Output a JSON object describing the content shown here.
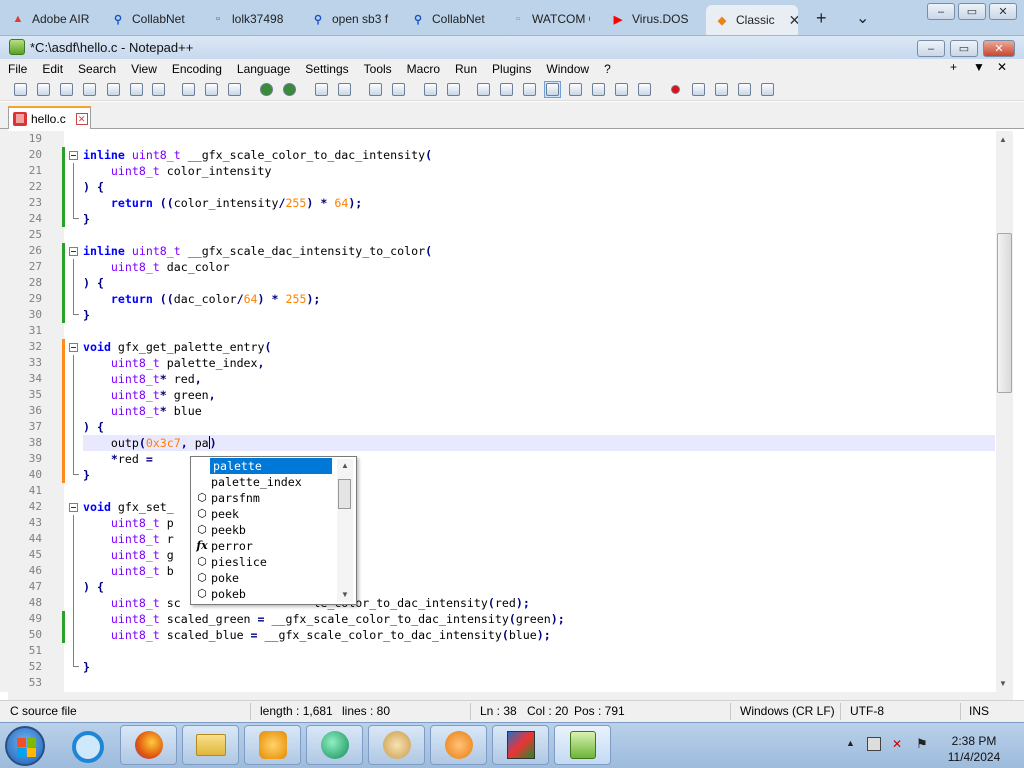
{
  "browser_tabs": [
    {
      "label": "Adobe AIR",
      "icon": "adobe-icon",
      "color": "#e03c31"
    },
    {
      "label": "CollabNet",
      "icon": "search-icon",
      "color": "#1a55c8"
    },
    {
      "label": "lolk37498",
      "icon": "document-icon",
      "color": "#555555"
    },
    {
      "label": "open sb3 f",
      "icon": "search-icon",
      "color": "#1a55c8"
    },
    {
      "label": "CollabNet",
      "icon": "search-icon",
      "color": "#1a55c8"
    },
    {
      "label": "WATCOM GM",
      "icon": "blank-icon",
      "color": "#888888"
    },
    {
      "label": "Virus.DOS",
      "icon": "youtube-icon",
      "color": "#ff0000"
    },
    {
      "label": "Classic",
      "icon": "scratch-icon",
      "color": "#e8841a",
      "active": true
    }
  ],
  "new_tab": "+",
  "tab_list": "⌄",
  "window_title": "*C:\\asdf\\hello.c - Notepad++",
  "menu": [
    "File",
    "Edit",
    "Search",
    "View",
    "Encoding",
    "Language",
    "Settings",
    "Tools",
    "Macro",
    "Run",
    "Plugins",
    "Window",
    "?"
  ],
  "menu_right": [
    "+",
    "▼",
    "✕"
  ],
  "document_tab": {
    "label": "hello.c",
    "close": "✕"
  },
  "editor": {
    "lines": [
      {
        "n": "19",
        "t": ""
      },
      {
        "n": "20",
        "t": "inline uint8_t __gfx_scale_color_to_dac_intensity("
      },
      {
        "n": "21",
        "t": "    uint8_t color_intensity"
      },
      {
        "n": "22",
        "t": ") {"
      },
      {
        "n": "23",
        "t": "    return ((color_intensity/255) * 64);"
      },
      {
        "n": "24",
        "t": "}"
      },
      {
        "n": "25",
        "t": ""
      },
      {
        "n": "26",
        "t": "inline uint8_t __gfx_scale_dac_intensity_to_color("
      },
      {
        "n": "27",
        "t": "    uint8_t dac_color"
      },
      {
        "n": "28",
        "t": ") {"
      },
      {
        "n": "29",
        "t": "    return ((dac_color/64) * 255);"
      },
      {
        "n": "30",
        "t": "}"
      },
      {
        "n": "31",
        "t": ""
      },
      {
        "n": "32",
        "t": "void gfx_get_palette_entry("
      },
      {
        "n": "33",
        "t": "    uint8_t palette_index,"
      },
      {
        "n": "34",
        "t": "    uint8_t* red,"
      },
      {
        "n": "35",
        "t": "    uint8_t* green,"
      },
      {
        "n": "36",
        "t": "    uint8_t* blue"
      },
      {
        "n": "37",
        "t": ") {"
      },
      {
        "n": "38",
        "t": "    outp(0x3c7, pa)"
      },
      {
        "n": "39",
        "t": "    *red ="
      },
      {
        "n": "40",
        "t": "}"
      },
      {
        "n": "41",
        "t": ""
      },
      {
        "n": "42",
        "t": "void gfx_set_"
      },
      {
        "n": "43",
        "t": "    uint8_t p"
      },
      {
        "n": "44",
        "t": "    uint8_t r"
      },
      {
        "n": "45",
        "t": "    uint8_t g"
      },
      {
        "n": "46",
        "t": "    uint8_t b"
      },
      {
        "n": "47",
        "t": ") {"
      },
      {
        "n": "48",
        "t": "    uint8_t sc                   le_color_to_dac_intensity(red);"
      },
      {
        "n": "49",
        "t": "    uint8_t scaled_green = __gfx_scale_color_to_dac_intensity(green);"
      },
      {
        "n": "50",
        "t": "    uint8_t scaled_blue = __gfx_scale_color_to_dac_intensity(blue);"
      },
      {
        "n": "51",
        "t": ""
      },
      {
        "n": "52",
        "t": "}"
      },
      {
        "n": "53",
        "t": ""
      }
    ]
  },
  "autocomplete": [
    {
      "label": "palette",
      "icon": "",
      "selected": true
    },
    {
      "label": "palette_index",
      "icon": ""
    },
    {
      "label": "parsfnm",
      "icon": "cube-icon"
    },
    {
      "label": "peek",
      "icon": "cube-icon"
    },
    {
      "label": "peekb",
      "icon": "cube-icon"
    },
    {
      "label": "perror",
      "icon": "function-icon"
    },
    {
      "label": "pieslice",
      "icon": "cube-icon"
    },
    {
      "label": "poke",
      "icon": "cube-icon"
    },
    {
      "label": "pokeb",
      "icon": "cube-icon"
    }
  ],
  "status": {
    "type": "C source file",
    "length": "length : 1,681",
    "lines": "lines : 80",
    "ln": "Ln : 38",
    "col": "Col : 20",
    "pos": "Pos : 791",
    "eol": "Windows (CR LF)",
    "encoding": "UTF-8",
    "mode": "INS"
  },
  "clock": {
    "time": "2:38 PM",
    "date": "11/4/2024"
  },
  "colors": {
    "keyword": "#0000ff",
    "type": "#8000ff",
    "number": "#ff8000",
    "selection": "#0078d7",
    "current_line": "#e8e8ff"
  }
}
